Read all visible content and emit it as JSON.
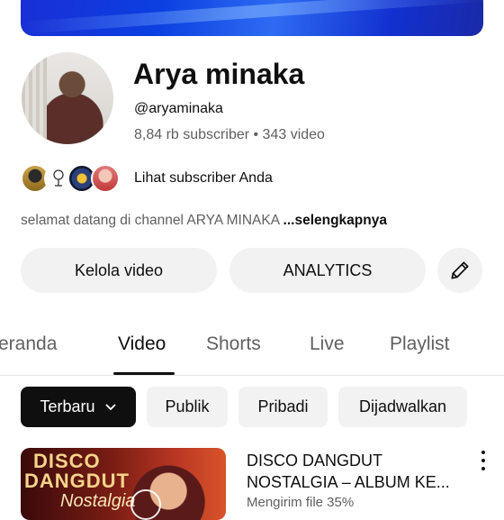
{
  "channel": {
    "name": "Arya minaka",
    "handle": "@aryaminaka",
    "stats": "8,84 rb subscriber • 343 video",
    "subscribers_link": "Lihat subscriber Anda",
    "description": "selamat datang di channel ARYA MINAKA ",
    "description_more": "...selengkapnya"
  },
  "actions": {
    "manage_videos": "Kelola video",
    "analytics": "ANALYTICS",
    "edit_icon": "pencil-icon"
  },
  "tabs": [
    {
      "label": "eranda"
    },
    {
      "label": "Video"
    },
    {
      "label": "Shorts"
    },
    {
      "label": "Live"
    },
    {
      "label": "Playlist"
    }
  ],
  "active_tab": "Video",
  "filters": [
    {
      "label": "Terbaru"
    },
    {
      "label": "Publik"
    },
    {
      "label": "Pribadi"
    },
    {
      "label": "Dijadwalkan"
    }
  ],
  "video": {
    "title_line1": "DISCO DANGDUT",
    "title_line2": "NOSTALGIA – ALBUM KE...",
    "status": "Mengirim file 35%",
    "thumbnail_text1": "DISCO",
    "thumbnail_text2": "DANGDUT",
    "thumbnail_text3": "Nostalgia"
  },
  "colors": {
    "banner": "#1a2fd6",
    "chip_selected": "#0f0f0f",
    "chip": "#f2f2f2",
    "secondary_text": "#606060"
  }
}
